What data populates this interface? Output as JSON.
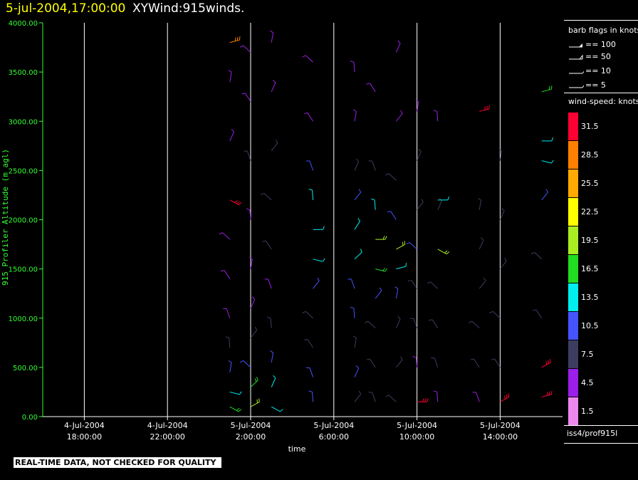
{
  "header": {
    "timestamp": "5-jul-2004,17:00:00",
    "product": "XYWind:915winds."
  },
  "legend": {
    "barb_title": "barb flags in knots",
    "barb_flags": [
      {
        "label": "== 100",
        "icon": "pennant-barb-icon"
      },
      {
        "label": "== 50",
        "icon": "double-flag-barb-icon"
      },
      {
        "label": "== 10",
        "icon": "full-barb-icon"
      },
      {
        "label": "== 5",
        "icon": "half-barb-icon"
      }
    ],
    "speed_title": "wind-speed: knots",
    "speed_scale": [
      {
        "label": "31.5",
        "color": "#ff0033"
      },
      {
        "label": "28.5",
        "color": "#ff7f00"
      },
      {
        "label": "25.5",
        "color": "#ffaa00"
      },
      {
        "label": "22.5",
        "color": "#ffff00"
      },
      {
        "label": "19.5",
        "color": "#aaee22"
      },
      {
        "label": "16.5",
        "color": "#22dd22"
      },
      {
        "label": "13.5",
        "color": "#00eeee"
      },
      {
        "label": "10.5",
        "color": "#4455ff"
      },
      {
        "label": "7.5",
        "color": "#3d3d60"
      },
      {
        "label": "4.5",
        "color": "#9b1fe8"
      },
      {
        "label": "1.5",
        "color": "#ee88ee"
      }
    ]
  },
  "source": "iss4/prof915l",
  "quality_notice": "REAL-TIME DATA, NOT CHECKED FOR QUALITY",
  "chart_data": {
    "type": "scatter",
    "title": "5-jul-2004,17:00:00 XYWind:915winds.",
    "xlabel": "time",
    "ylabel": "915 Profiler Altitude (m agl)",
    "ylim": [
      0,
      4000
    ],
    "xlim": [
      "2004-07-04 16:00",
      "2004-07-05 17:00"
    ],
    "yticks": [
      "0.00",
      "500.00",
      "1000.00",
      "1500.00",
      "2000.00",
      "2500.00",
      "3000.00",
      "3500.00",
      "4000.00"
    ],
    "xticks": [
      {
        "date": "4-Jul-2004",
        "time": "18:00:00"
      },
      {
        "date": "4-Jul-2004",
        "time": "22:00:00"
      },
      {
        "date": "5-Jul-2004",
        "time": "2:00:00"
      },
      {
        "date": "5-Jul-2004",
        "time": "6:00:00"
      },
      {
        "date": "5-Jul-2004",
        "time": "10:00:00"
      },
      {
        "date": "5-Jul-2004",
        "time": "14:00:00"
      }
    ],
    "grid": "vertical lines at x ticks",
    "series": [
      {
        "points": [
          {
            "time": "2004-07-05 01:00",
            "alt": 100,
            "spd": 17
          },
          {
            "time": "2004-07-05 01:00",
            "alt": 250,
            "spd": 14
          },
          {
            "time": "2004-07-05 01:00",
            "alt": 450,
            "spd": 10
          },
          {
            "time": "2004-07-05 01:00",
            "alt": 700,
            "spd": 7
          },
          {
            "time": "2004-07-05 01:00",
            "alt": 1000,
            "spd": 5
          },
          {
            "time": "2004-07-05 01:00",
            "alt": 1400,
            "spd": 4
          },
          {
            "time": "2004-07-05 01:00",
            "alt": 1800,
            "spd": 3
          },
          {
            "time": "2004-07-05 01:00",
            "alt": 2200,
            "spd": 31
          },
          {
            "time": "2004-07-05 01:00",
            "alt": 2800,
            "spd": 5
          },
          {
            "time": "2004-07-05 01:00",
            "alt": 3400,
            "spd": 4
          },
          {
            "time": "2004-07-05 01:00",
            "alt": 3800,
            "spd": 28
          },
          {
            "time": "2004-07-05 02:00",
            "alt": 100,
            "spd": 18
          },
          {
            "time": "2004-07-05 02:00",
            "alt": 300,
            "spd": 15
          },
          {
            "time": "2004-07-05 02:00",
            "alt": 500,
            "spd": 11
          },
          {
            "time": "2004-07-05 02:00",
            "alt": 800,
            "spd": 8
          },
          {
            "time": "2004-07-05 02:00",
            "alt": 1100,
            "spd": 5
          },
          {
            "time": "2004-07-05 02:00",
            "alt": 1500,
            "spd": 4
          },
          {
            "time": "2004-07-05 02:00",
            "alt": 2000,
            "spd": 4
          },
          {
            "time": "2004-07-05 02:00",
            "alt": 2600,
            "spd": 6
          },
          {
            "time": "2004-07-05 02:00",
            "alt": 3200,
            "spd": 4
          },
          {
            "time": "2004-07-05 02:00",
            "alt": 3700,
            "spd": 5
          },
          {
            "time": "2004-07-05 03:00",
            "alt": 100,
            "spd": 13
          },
          {
            "time": "2004-07-05 03:00",
            "alt": 300,
            "spd": 12
          },
          {
            "time": "2004-07-05 03:00",
            "alt": 550,
            "spd": 10
          },
          {
            "time": "2004-07-05 03:00",
            "alt": 900,
            "spd": 7
          },
          {
            "time": "2004-07-05 03:00",
            "alt": 1300,
            "spd": 5
          },
          {
            "time": "2004-07-05 03:00",
            "alt": 1700,
            "spd": 6
          },
          {
            "time": "2004-07-05 03:00",
            "alt": 2200,
            "spd": 8
          },
          {
            "time": "2004-07-05 03:00",
            "alt": 2700,
            "spd": 6
          },
          {
            "time": "2004-07-05 03:00",
            "alt": 3300,
            "spd": 5
          },
          {
            "time": "2004-07-05 03:00",
            "alt": 3800,
            "spd": 4
          },
          {
            "time": "2004-07-05 05:00",
            "alt": 150,
            "spd": 10
          },
          {
            "time": "2004-07-05 05:00",
            "alt": 400,
            "spd": 9
          },
          {
            "time": "2004-07-05 05:00",
            "alt": 700,
            "spd": 7
          },
          {
            "time": "2004-07-05 05:00",
            "alt": 1000,
            "spd": 8
          },
          {
            "time": "2004-07-05 05:00",
            "alt": 1300,
            "spd": 10
          },
          {
            "time": "2004-07-05 05:00",
            "alt": 1600,
            "spd": 13
          },
          {
            "time": "2004-07-05 05:00",
            "alt": 1900,
            "spd": 14
          },
          {
            "time": "2004-07-05 05:00",
            "alt": 2200,
            "spd": 12
          },
          {
            "time": "2004-07-05 05:00",
            "alt": 2500,
            "spd": 9
          },
          {
            "time": "2004-07-05 05:00",
            "alt": 3000,
            "spd": 5
          },
          {
            "time": "2004-07-05 05:00",
            "alt": 3600,
            "spd": 4
          },
          {
            "time": "2004-07-05 07:00",
            "alt": 150,
            "spd": 8
          },
          {
            "time": "2004-07-05 07:00",
            "alt": 400,
            "spd": 9
          },
          {
            "time": "2004-07-05 07:00",
            "alt": 700,
            "spd": 8
          },
          {
            "time": "2004-07-05 07:00",
            "alt": 1000,
            "spd": 9
          },
          {
            "time": "2004-07-05 07:00",
            "alt": 1300,
            "spd": 11
          },
          {
            "time": "2004-07-05 07:00",
            "alt": 1600,
            "spd": 14
          },
          {
            "time": "2004-07-05 07:00",
            "alt": 1900,
            "spd": 13
          },
          {
            "time": "2004-07-05 07:00",
            "alt": 2200,
            "spd": 10
          },
          {
            "time": "2004-07-05 07:00",
            "alt": 2500,
            "spd": 8
          },
          {
            "time": "2004-07-05 07:00",
            "alt": 3000,
            "spd": 5
          },
          {
            "time": "2004-07-05 07:00",
            "alt": 3500,
            "spd": 4
          },
          {
            "time": "2004-07-05 08:00",
            "alt": 150,
            "spd": 7
          },
          {
            "time": "2004-07-05 08:00",
            "alt": 500,
            "spd": 8
          },
          {
            "time": "2004-07-05 08:00",
            "alt": 900,
            "spd": 8
          },
          {
            "time": "2004-07-05 08:00",
            "alt": 1200,
            "spd": 11
          },
          {
            "time": "2004-07-05 08:00",
            "alt": 1500,
            "spd": 15
          },
          {
            "time": "2004-07-05 08:00",
            "alt": 1800,
            "spd": 18
          },
          {
            "time": "2004-07-05 08:00",
            "alt": 2100,
            "spd": 12
          },
          {
            "time": "2004-07-05 08:00",
            "alt": 2500,
            "spd": 8
          },
          {
            "time": "2004-07-05 08:00",
            "alt": 3300,
            "spd": 5
          },
          {
            "time": "2004-07-05 09:00",
            "alt": 150,
            "spd": 7
          },
          {
            "time": "2004-07-05 09:00",
            "alt": 500,
            "spd": 7
          },
          {
            "time": "2004-07-05 09:00",
            "alt": 900,
            "spd": 8
          },
          {
            "time": "2004-07-05 09:00",
            "alt": 1200,
            "spd": 10
          },
          {
            "time": "2004-07-05 09:00",
            "alt": 1500,
            "spd": 14
          },
          {
            "time": "2004-07-05 09:00",
            "alt": 1700,
            "spd": 19
          },
          {
            "time": "2004-07-05 09:00",
            "alt": 2000,
            "spd": 11
          },
          {
            "time": "2004-07-05 09:00",
            "alt": 2400,
            "spd": 7
          },
          {
            "time": "2004-07-05 09:00",
            "alt": 3000,
            "spd": 5
          },
          {
            "time": "2004-07-05 09:00",
            "alt": 3700,
            "spd": 4
          },
          {
            "time": "2004-07-05 10:00",
            "alt": 150,
            "spd": 31
          },
          {
            "time": "2004-07-05 10:00",
            "alt": 500,
            "spd": 5
          },
          {
            "time": "2004-07-05 10:00",
            "alt": 900,
            "spd": 6
          },
          {
            "time": "2004-07-05 10:00",
            "alt": 1300,
            "spd": 8
          },
          {
            "time": "2004-07-05 10:00",
            "alt": 1700,
            "spd": 9
          },
          {
            "time": "2004-07-05 10:00",
            "alt": 2100,
            "spd": 7
          },
          {
            "time": "2004-07-05 10:00",
            "alt": 2600,
            "spd": 6
          },
          {
            "time": "2004-07-05 10:00",
            "alt": 3100,
            "spd": 5
          },
          {
            "time": "2004-07-05 11:00",
            "alt": 150,
            "spd": 4
          },
          {
            "time": "2004-07-05 11:00",
            "alt": 500,
            "spd": 6
          },
          {
            "time": "2004-07-05 11:00",
            "alt": 900,
            "spd": 7
          },
          {
            "time": "2004-07-05 11:00",
            "alt": 1300,
            "spd": 8
          },
          {
            "time": "2004-07-05 11:00",
            "alt": 1700,
            "spd": 18
          },
          {
            "time": "2004-07-05 11:00",
            "alt": 2100,
            "spd": 8
          },
          {
            "time": "2004-07-05 11:00",
            "alt": 2200,
            "spd": 13
          },
          {
            "time": "2004-07-05 11:00",
            "alt": 3000,
            "spd": 4
          },
          {
            "time": "2004-07-05 13:00",
            "alt": 150,
            "spd": 5
          },
          {
            "time": "2004-07-05 13:00",
            "alt": 500,
            "spd": 6
          },
          {
            "time": "2004-07-05 13:00",
            "alt": 900,
            "spd": 7
          },
          {
            "time": "2004-07-05 13:00",
            "alt": 1300,
            "spd": 8
          },
          {
            "time": "2004-07-05 13:00",
            "alt": 1700,
            "spd": 8
          },
          {
            "time": "2004-07-05 13:00",
            "alt": 2100,
            "spd": 7
          },
          {
            "time": "2004-07-05 13:00",
            "alt": 3100,
            "spd": 31
          },
          {
            "time": "2004-07-05 14:00",
            "alt": 150,
            "spd": 31
          },
          {
            "time": "2004-07-05 14:00",
            "alt": 500,
            "spd": 6
          },
          {
            "time": "2004-07-05 14:00",
            "alt": 1000,
            "spd": 7
          },
          {
            "time": "2004-07-05 14:00",
            "alt": 1500,
            "spd": 8
          },
          {
            "time": "2004-07-05 14:00",
            "alt": 2000,
            "spd": 7
          },
          {
            "time": "2004-07-05 14:00",
            "alt": 2600,
            "spd": 6
          },
          {
            "time": "2004-07-05 16:00",
            "alt": 200,
            "spd": 31
          },
          {
            "time": "2004-07-05 16:00",
            "alt": 500,
            "spd": 31
          },
          {
            "time": "2004-07-05 16:00",
            "alt": 1000,
            "spd": 6
          },
          {
            "time": "2004-07-05 16:00",
            "alt": 1600,
            "spd": 8
          },
          {
            "time": "2004-07-05 16:00",
            "alt": 2200,
            "spd": 9
          },
          {
            "time": "2004-07-05 16:00",
            "alt": 2600,
            "spd": 13
          },
          {
            "time": "2004-07-05 16:00",
            "alt": 2800,
            "spd": 14
          },
          {
            "time": "2004-07-05 16:00",
            "alt": 3300,
            "spd": 17
          }
        ]
      }
    ]
  }
}
